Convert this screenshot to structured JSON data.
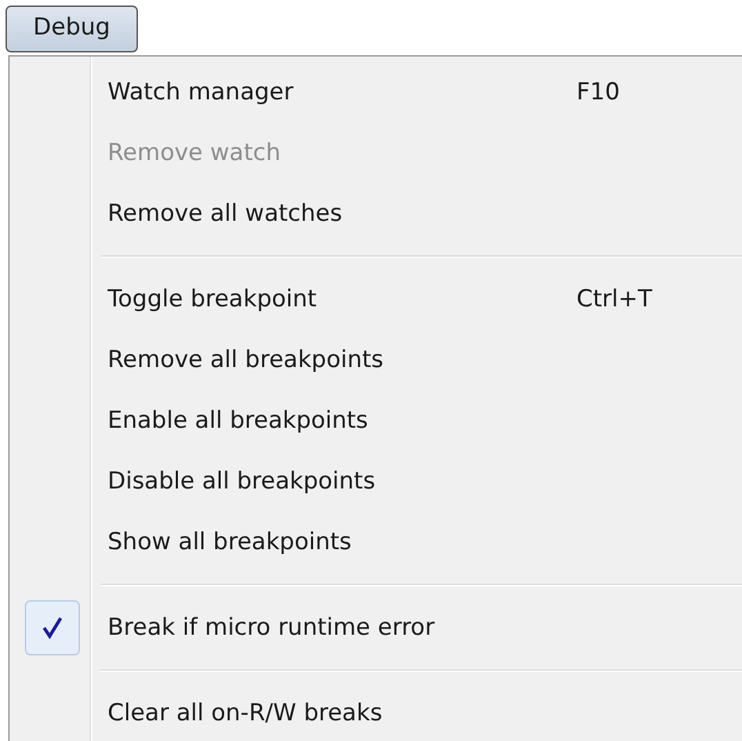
{
  "menu_title": "Debug",
  "items": [
    {
      "kind": "item",
      "label": "Watch manager",
      "shortcut": "F10",
      "disabled": false,
      "checked": false
    },
    {
      "kind": "item",
      "label": "Remove watch",
      "disabled": true,
      "checked": false
    },
    {
      "kind": "item",
      "label": "Remove all watches",
      "disabled": false,
      "checked": false
    },
    {
      "kind": "separator"
    },
    {
      "kind": "item",
      "label": "Toggle breakpoint",
      "shortcut": "Ctrl+T",
      "disabled": false,
      "checked": false
    },
    {
      "kind": "item",
      "label": "Remove all breakpoints",
      "disabled": false,
      "checked": false
    },
    {
      "kind": "item",
      "label": "Enable all breakpoints",
      "disabled": false,
      "checked": false
    },
    {
      "kind": "item",
      "label": "Disable all breakpoints",
      "disabled": false,
      "checked": false
    },
    {
      "kind": "item",
      "label": "Show all breakpoints",
      "disabled": false,
      "checked": false
    },
    {
      "kind": "separator"
    },
    {
      "kind": "item",
      "label": "Break if micro runtime error",
      "disabled": false,
      "checked": true
    },
    {
      "kind": "separator"
    },
    {
      "kind": "item",
      "label": "Clear all on-R/W breaks",
      "disabled": false,
      "checked": false
    }
  ]
}
